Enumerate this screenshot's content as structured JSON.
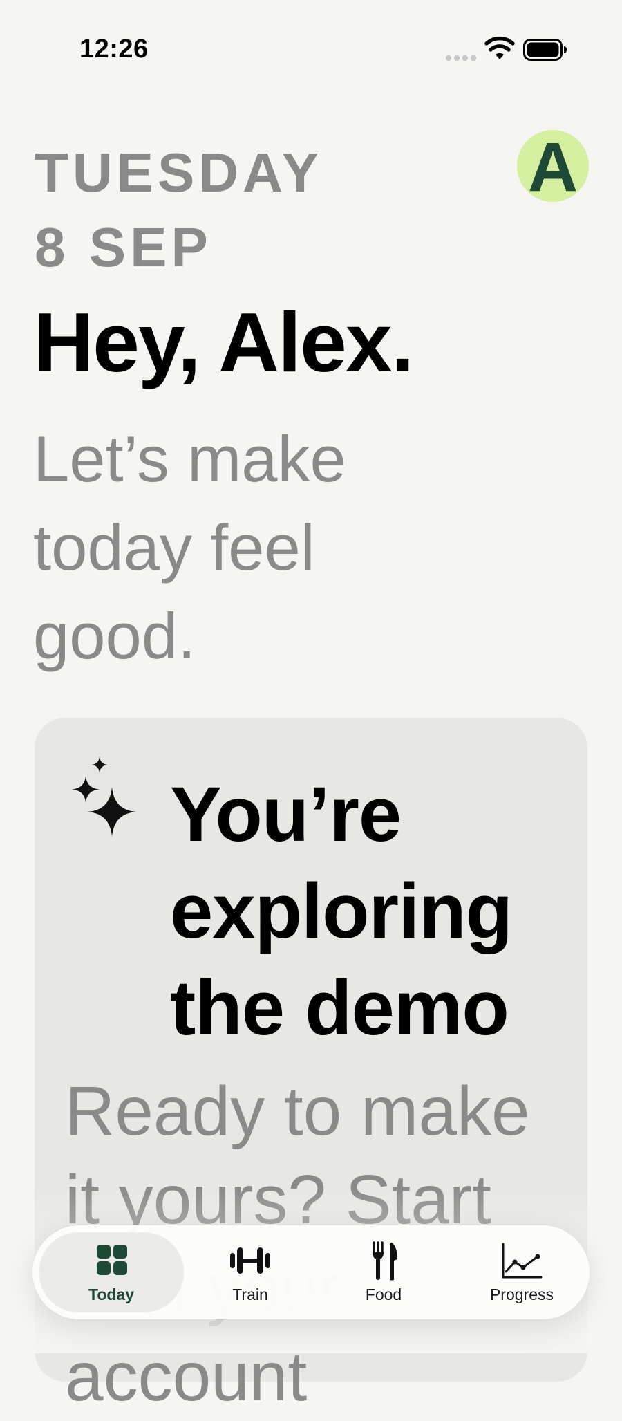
{
  "status_bar": {
    "time": "12:26"
  },
  "header": {
    "date_label": "TUESDAY\n8 SEP",
    "avatar_initial": "A",
    "greeting": "Hey, Alex.",
    "subtitle": "Let’s make today feel good."
  },
  "demo_card": {
    "icon": "sparkles-icon",
    "title": "You’re exploring the demo",
    "body": "Ready to make it yours? Start with your account"
  },
  "tab_bar": {
    "tabs": [
      {
        "label": "Today",
        "icon": "grid-icon",
        "selected": true
      },
      {
        "label": "Train",
        "icon": "dumbbell-icon",
        "selected": false
      },
      {
        "label": "Food",
        "icon": "fork-knife-icon",
        "selected": false
      },
      {
        "label": "Progress",
        "icon": "chart-line-icon",
        "selected": false
      }
    ]
  },
  "colors": {
    "background": "#f5f5f2",
    "card": "#e7e7e3",
    "muted_text": "#8a8a8a",
    "accent_dark_green": "#1e4a35",
    "avatar_bg": "#d4ef9f"
  }
}
